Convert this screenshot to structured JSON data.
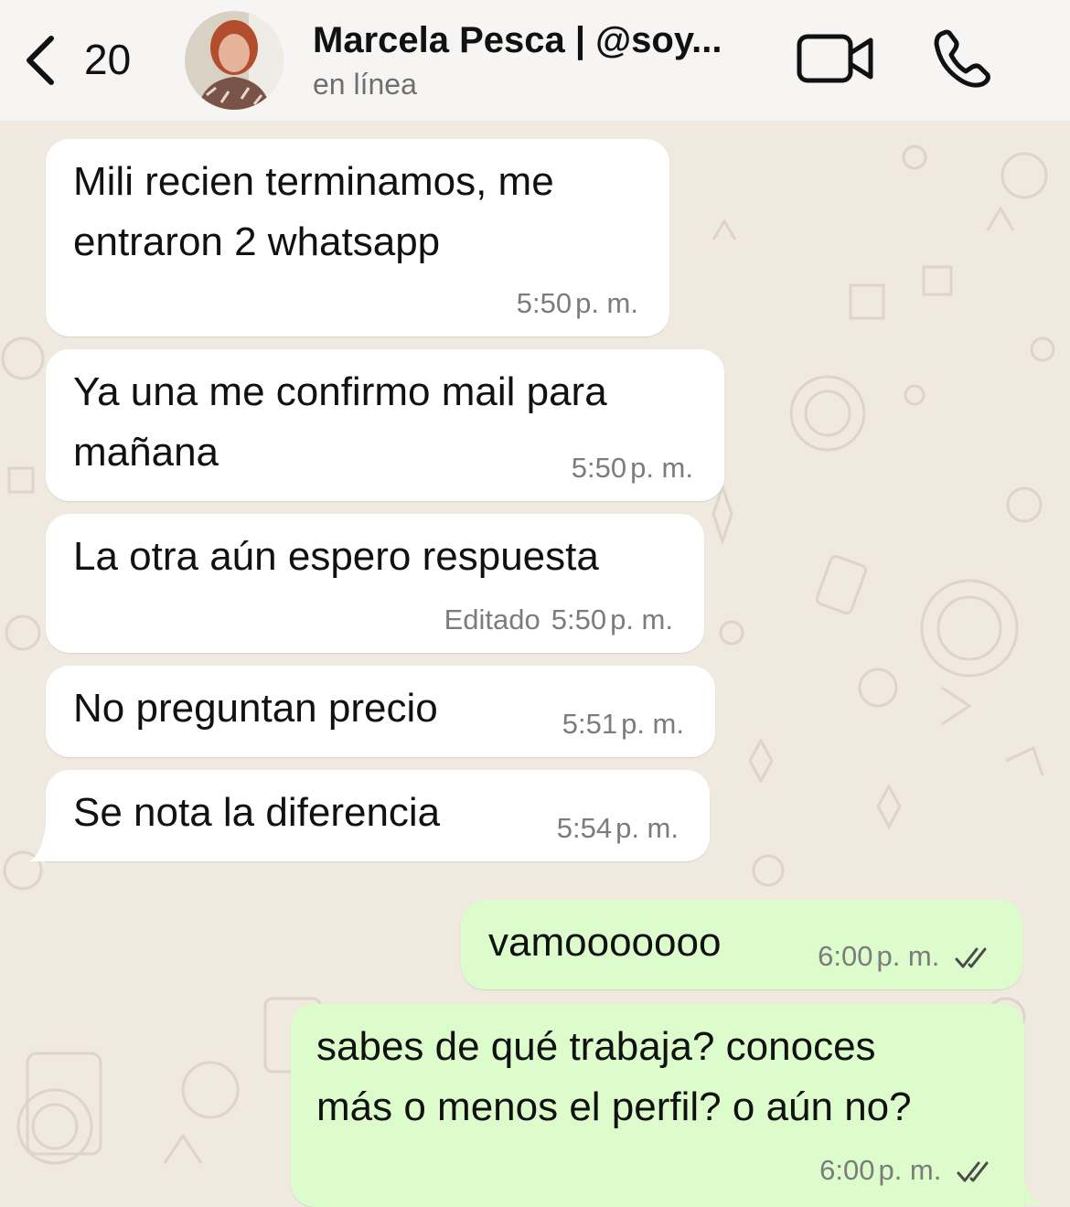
{
  "header": {
    "back_count": "20",
    "contact_name": "Marcela Pesca | @soy...",
    "status": "en línea"
  },
  "messages": [
    {
      "direction": "in",
      "lines": [
        "Mili recien terminamos, me",
        "entraron 2 whatsapp"
      ],
      "time": "5:50",
      "ampm": "p. m."
    },
    {
      "direction": "in",
      "lines": [
        "Ya una me confirmo mail para",
        "mañana"
      ],
      "time": "5:50",
      "ampm": "p. m."
    },
    {
      "direction": "in",
      "lines": [
        "La otra aún espero respuesta"
      ],
      "edited": "Editado",
      "time": "5:50",
      "ampm": "p. m."
    },
    {
      "direction": "in",
      "lines": [
        "No preguntan precio"
      ],
      "time": "5:51",
      "ampm": "p. m."
    },
    {
      "direction": "in",
      "lines": [
        "Se nota la diferencia"
      ],
      "time": "5:54",
      "ampm": "p. m."
    },
    {
      "direction": "out",
      "lines": [
        "vamooooooo"
      ],
      "time": "6:00",
      "ampm": "p. m.",
      "read": true
    },
    {
      "direction": "out",
      "lines": [
        "sabes de qué trabaja? conoces",
        "más o menos el perfil? o aún no?"
      ],
      "time": "6:00",
      "ampm": "p. m.",
      "read": true
    }
  ],
  "icons": {
    "back": "chevron-left-icon",
    "video": "video-camera-icon",
    "call": "phone-icon",
    "read_receipt": "double-check-icon"
  },
  "colors": {
    "incoming_bubble": "#ffffff",
    "outgoing_bubble": "#dcfccc",
    "read_ticks": "#4a4a4a",
    "wallpaper": "#efe9df"
  }
}
